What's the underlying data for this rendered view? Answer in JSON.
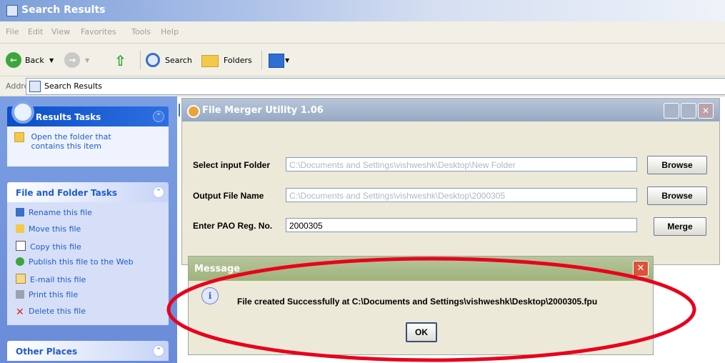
{
  "explorer": {
    "title": "Search Results",
    "menu": [
      "File",
      "Edit",
      "View",
      "Favorites",
      "Tools",
      "Help"
    ],
    "toolbar": {
      "back": "Back",
      "search": "Search",
      "folders": "Folders"
    },
    "address_label": "Address",
    "address_value": "Search Results"
  },
  "sidebar": {
    "results_tasks": {
      "title": "Results Tasks",
      "items": [
        "Open the folder that contains this item"
      ]
    },
    "file_folder_tasks": {
      "title": "File and Folder Tasks",
      "items": [
        "Rename this file",
        "Move this file",
        "Copy this file",
        "Publish this file to the Web",
        "E-mail this file",
        "Print this file",
        "Delete this file"
      ]
    },
    "other_places": {
      "title": "Other Places"
    }
  },
  "file_merger": {
    "title": "File Merger Utility 1.06",
    "input_folder_label": "Select input Folder",
    "input_folder_value": "C:\\Documents and Settings\\vishweshk\\Desktop\\New Folder",
    "output_file_label": "Output File Name",
    "output_file_value": "C:\\Documents and Settings\\vishweshk\\Desktop\\2000305",
    "pao_label": "Enter PAO Reg. No.",
    "pao_value": "2000305",
    "browse_label": "Browse",
    "merge_label": "Merge"
  },
  "message": {
    "title": "Message",
    "text": "File created Successfully at C:\\Documents and Settings\\vishweshk\\Desktop\\2000305.fpu",
    "ok_label": "OK"
  },
  "colors": {
    "annotation_ring": "#e8001c",
    "xp_blue": "#215dc6"
  }
}
